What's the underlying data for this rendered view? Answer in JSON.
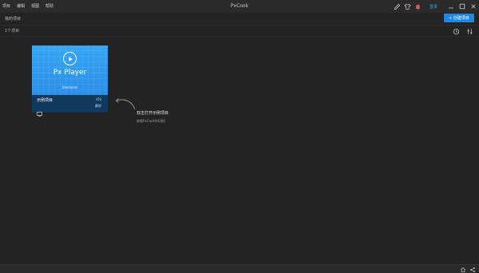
{
  "menubar": {
    "items": [
      "项目",
      "编辑",
      "视图",
      "帮助"
    ]
  },
  "app": {
    "title": "PxCook"
  },
  "account": {
    "login_label": "登录"
  },
  "header": {
    "page_title": "我的项目",
    "create_label": "+ 创建项目"
  },
  "subbar": {
    "project_count": "1个项目"
  },
  "project_card": {
    "brand": "Px Player",
    "brand_tag": "Usemonic",
    "name": "示例项目",
    "platform": "iOS",
    "delete_label": "删除"
  },
  "hint": {
    "title": "双击打开示例项目",
    "subtitle": "查看PxCook的切图!"
  },
  "colors": {
    "accent": "#1e88e5",
    "thumb_blue": "#36a6f2",
    "card_footer": "#0f3a5e",
    "background": "#232323"
  },
  "icons": {
    "title_right": [
      "pen-icon",
      "shirt-icon",
      "bell-icon"
    ],
    "window": [
      "minimize-icon",
      "maximize-icon",
      "close-icon"
    ],
    "toolbar": [
      "history-icon",
      "sliders-icon"
    ],
    "status": [
      "home-icon",
      "share-icon"
    ]
  }
}
